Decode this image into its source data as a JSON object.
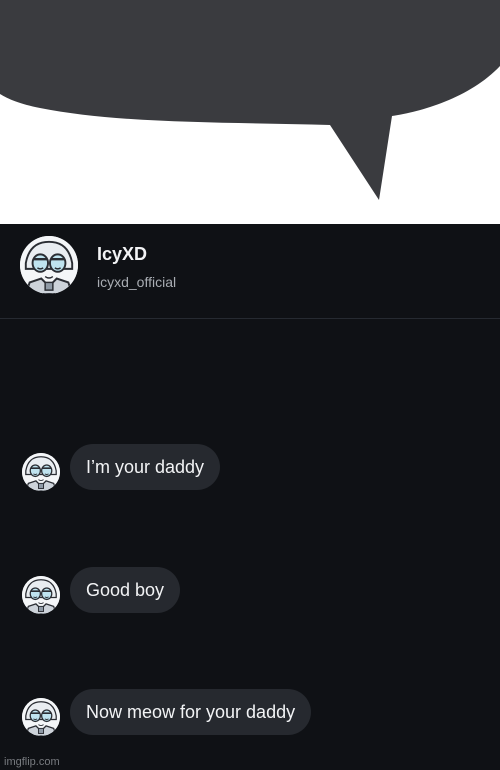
{
  "profile": {
    "display_name": "IcyXD",
    "username": "icyxd_official",
    "avatar_icon": "anime-face-avatar-icon"
  },
  "messages": [
    {
      "text": "I’m your daddy"
    },
    {
      "text": "Good boy"
    },
    {
      "text": "Now meow for your daddy"
    }
  ],
  "watermark": "imgflip.com",
  "colors": {
    "bubble_overlay": "#3a3b3f",
    "chat_background": "#0f1115",
    "message_bubble": "#26292f",
    "text_primary": "#f2f3f5",
    "text_secondary": "#a9adb3"
  }
}
